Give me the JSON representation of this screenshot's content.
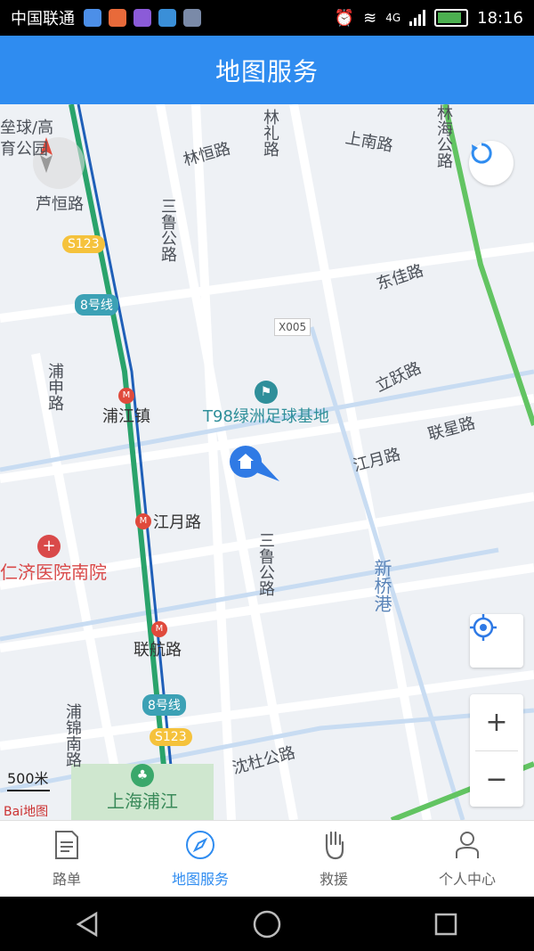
{
  "status_bar": {
    "carrier": "中国联通",
    "network": "4G",
    "time": "18:16"
  },
  "header": {
    "title": "地图服务"
  },
  "map": {
    "labels": {
      "nw_park": "垒球/高\n育公园",
      "luheng": "芦恒路",
      "linheng": "林恒路",
      "linli": "林礼路",
      "shangnan": "上南路",
      "linhai": "林海公路",
      "sanlu_top": "三鲁公路",
      "dongjia": "东佳路",
      "puyan": "浦申路",
      "lichen": "立跃路",
      "t98": "T98绿洲足球基地",
      "lianxing": "联星路",
      "jiangyue_e": "江月路",
      "jiangyue_w": "江月路",
      "pujiang_town": "浦江镇",
      "hospital": "仁济医院南院",
      "sanlu_mid": "三鲁公路",
      "xinqiao": "新桥港",
      "lianhang": "联航路",
      "pujin": "浦锦南路",
      "shendu": "沈杜公路",
      "shanghai_pujiang": "上海浦江"
    },
    "shields": {
      "s123_top": "S123",
      "line8_top": "8号线",
      "x005": "X005",
      "line8_bottom": "8号线",
      "s123_bottom": "S123"
    },
    "scale": "500米",
    "attribution": "Bai地图"
  },
  "bottom_nav": [
    {
      "label": "路单",
      "icon": "document-icon",
      "active": false
    },
    {
      "label": "地图服务",
      "icon": "compass-icon",
      "active": true
    },
    {
      "label": "救援",
      "icon": "hand-icon",
      "active": false
    },
    {
      "label": "个人中心",
      "icon": "person-icon",
      "active": false
    }
  ],
  "colors": {
    "accent": "#2f8cf0",
    "map_bg": "#eef1f5",
    "metro_line": "#2aa36b",
    "hospital": "#d94a4a"
  }
}
